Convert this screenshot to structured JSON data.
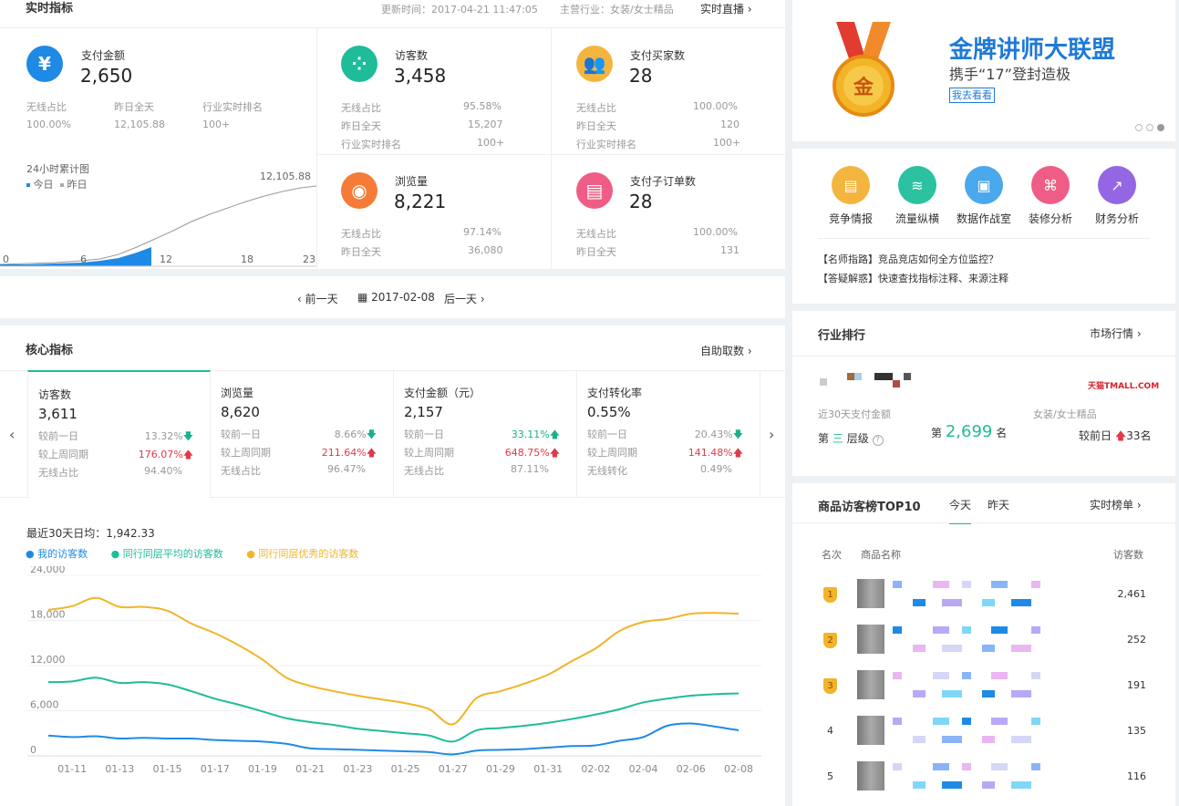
{
  "realtime": {
    "title": "实时指标",
    "update_time": "更新时间：2017-04-21 11:47:05",
    "industry": "主营行业：女装/女士精品",
    "live_link": "实时直播",
    "pay": {
      "label": "支付金额",
      "value": "2,650",
      "m1": "无线占比",
      "m1v": "100.00%",
      "m2": "昨日全天",
      "m2v": "12,105.88",
      "m3": "行业实时排名",
      "m3v": "100+"
    },
    "chart24": {
      "title": "24小时累计图",
      "legend_today": "今日",
      "legend_yest": "昨日",
      "peak": "12,105.88",
      "ticks": [
        "0",
        "6",
        "12",
        "18",
        "23"
      ]
    },
    "visitors": {
      "label": "访客数",
      "value": "3,458",
      "m1": "无线占比",
      "m1v": "95.58%",
      "m2": "昨日全天",
      "m2v": "15,207",
      "m3": "行业实时排名",
      "m3v": "100+"
    },
    "buyers": {
      "label": "支付买家数",
      "value": "28",
      "m1": "无线占比",
      "m1v": "100.00%",
      "m2": "昨日全天",
      "m2v": "120",
      "m3": "行业实时排名",
      "m3v": "100+"
    },
    "pv": {
      "label": "浏览量",
      "value": "8,221",
      "m1": "无线占比",
      "m1v": "97.14%",
      "m2": "昨日全天",
      "m2v": "36,080"
    },
    "orders": {
      "label": "支付子订单数",
      "value": "28",
      "m1": "无线占比",
      "m1v": "100.00%",
      "m2": "昨日全天",
      "m2v": "131"
    }
  },
  "datebar": {
    "prev": "前一天",
    "date": "2017-02-08",
    "next": "后一天"
  },
  "core": {
    "title": "核心指标",
    "link": "自助取数",
    "cards": [
      {
        "label": "访客数",
        "value": "3,611",
        "r1": "较前一日",
        "r1v": "13.32%",
        "r2": "较上周同期",
        "r2v": "176.07%",
        "r3": "无线占比",
        "r3v": "94.40%"
      },
      {
        "label": "浏览量",
        "value": "8,620",
        "r1": "较前一日",
        "r1v": "8.66%",
        "r2": "较上周同期",
        "r2v": "211.64%",
        "r3": "无线占比",
        "r3v": "96.47%"
      },
      {
        "label": "支付金额（元）",
        "value": "2,157",
        "r1": "较前一日",
        "r1v": "33.11%",
        "r2": "较上周同期",
        "r2v": "648.75%",
        "r3": "无线占比",
        "r3v": "87.11%"
      },
      {
        "label": "支付转化率",
        "value": "0.55%",
        "r1": "较前一日",
        "r1v": "20.43%",
        "r2": "较上周同期",
        "r2v": "141.48%",
        "r3": "无线转化",
        "r3v": "0.49%"
      }
    ],
    "avg": "最近30天日均：1,942.33"
  },
  "chart_data": {
    "type": "line",
    "x": [
      "01-10",
      "01-11",
      "01-12",
      "01-13",
      "01-14",
      "01-15",
      "01-16",
      "01-17",
      "01-18",
      "01-19",
      "01-20",
      "01-21",
      "01-22",
      "01-23",
      "01-24",
      "01-25",
      "01-26",
      "01-27",
      "01-28",
      "01-29",
      "01-30",
      "01-31",
      "02-01",
      "02-02",
      "02-03",
      "02-04",
      "02-05",
      "02-06",
      "02-07",
      "02-08"
    ],
    "xticks": [
      "01-11",
      "01-13",
      "01-15",
      "01-17",
      "01-19",
      "01-21",
      "01-23",
      "01-25",
      "01-27",
      "01-29",
      "01-31",
      "02-02",
      "02-04",
      "02-06",
      "02-08"
    ],
    "yticks": [
      "24,000",
      "18,000",
      "12,000",
      "6,000",
      "0"
    ],
    "ylim": [
      0,
      24000
    ],
    "series": [
      {
        "name": "我的访客数",
        "color": "#1f8ae6",
        "values": [
          2700,
          2500,
          2600,
          2300,
          2400,
          2300,
          2300,
          2100,
          2000,
          1900,
          1600,
          1000,
          900,
          800,
          700,
          600,
          500,
          200,
          700,
          800,
          900,
          1100,
          1300,
          1400,
          2000,
          2500,
          4000,
          4300,
          3900,
          3400
        ]
      },
      {
        "name": "同行同层平均的访客数",
        "color": "#1fbc9a",
        "values": [
          9800,
          9900,
          10400,
          9700,
          9800,
          9500,
          8600,
          7600,
          6800,
          5900,
          5000,
          4500,
          4100,
          3600,
          3300,
          3000,
          2700,
          1900,
          3400,
          3700,
          4000,
          4400,
          4900,
          5500,
          6200,
          7100,
          7600,
          8000,
          8200,
          8300
        ]
      },
      {
        "name": "同行同层优秀的访客数",
        "color": "#f2b428",
        "values": [
          19400,
          19900,
          21000,
          19800,
          19800,
          19300,
          17600,
          16300,
          14700,
          12800,
          10400,
          9300,
          8600,
          8000,
          7500,
          7000,
          6200,
          4200,
          7700,
          8600,
          9600,
          10800,
          12600,
          14300,
          16600,
          17800,
          18200,
          18900,
          19000,
          18900
        ]
      }
    ]
  },
  "promo": {
    "title": "金牌讲师大联盟",
    "subtitle": "携手“17”登封造极",
    "button": "我去看看",
    "medal_text": "金"
  },
  "tools": {
    "items": [
      {
        "label": "竞争情报",
        "color": "#f4b53f"
      },
      {
        "label": "流量纵横",
        "color": "#2cc1a0"
      },
      {
        "label": "数据作战室",
        "color": "#4aa8ec"
      },
      {
        "label": "装修分析",
        "color": "#ef5d86"
      },
      {
        "label": "财务分析",
        "color": "#9466e4"
      }
    ],
    "link1": "【名师指路】竞品竞店如何全方位监控？",
    "link2": "【答疑解惑】快速查找指标注释、来源注释"
  },
  "rank": {
    "title": "行业排行",
    "link": "市场行情",
    "tmall": "天猫TMALL.COM",
    "m1": "近30天支付金额",
    "m2": "女装/女士精品",
    "tier_prefix": "第",
    "tier": "三",
    "tier_suffix": "层级",
    "rank_prefix": "第",
    "rank": "2,699",
    "rank_suffix": "名",
    "cmp": "较前日",
    "cmp_val": "33名"
  },
  "top10": {
    "title": "商品访客榜TOP10",
    "tab_today": "今天",
    "tab_yest": "昨天",
    "link": "实时榜单",
    "col_rank": "名次",
    "col_name": "商品名称",
    "col_visits": "访客数",
    "rows": [
      {
        "rank": "1",
        "visits": "2,461"
      },
      {
        "rank": "2",
        "visits": "252"
      },
      {
        "rank": "3",
        "visits": "191"
      },
      {
        "rank": "4",
        "visits": "135"
      },
      {
        "rank": "5",
        "visits": "116"
      }
    ]
  }
}
